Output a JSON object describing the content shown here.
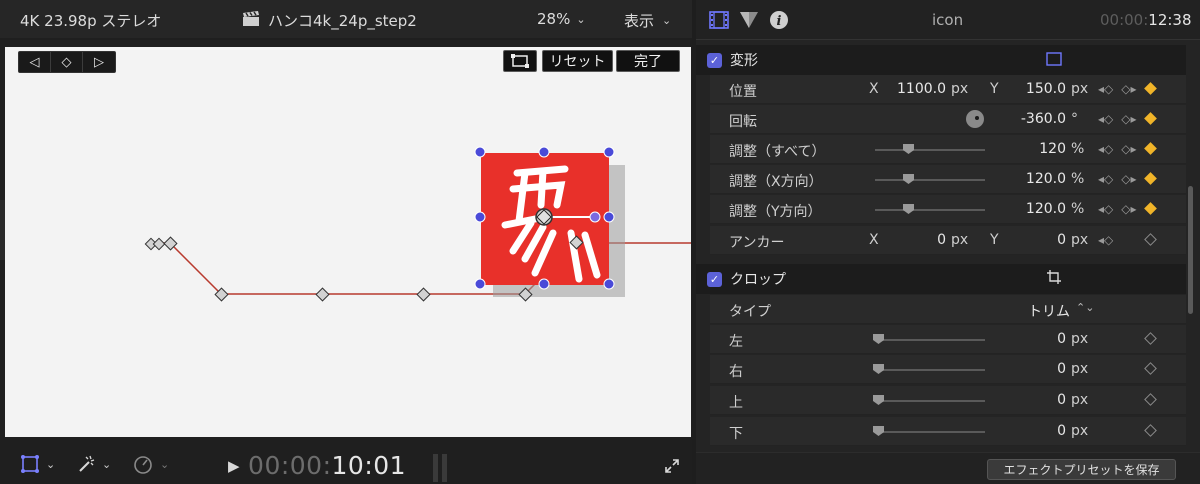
{
  "viewer": {
    "format": "4K 23.98p ステレオ",
    "project_title": "ハンコ4k_24p_step2",
    "zoom": "28%",
    "view_menu": "表示",
    "overlay": {
      "reset_label": "リセット",
      "done_label": "完了"
    },
    "timecode_dim": "00:00:",
    "timecode_bright": "10:01"
  },
  "inspector": {
    "clip_name": "icon",
    "duration_dim": "00:00:",
    "duration_bright": "12:38",
    "transform": {
      "label": "変形",
      "position": {
        "label": "位置",
        "x_axis": "X",
        "x_value": "1100.0",
        "x_unit": "px",
        "y_axis": "Y",
        "y_value": "150.0",
        "y_unit": "px"
      },
      "rotation": {
        "label": "回転",
        "value": "-360.0",
        "unit": "°"
      },
      "scale_all": {
        "label": "調整（すべて）",
        "value": "120",
        "unit": "%"
      },
      "scale_x": {
        "label": "調整（X方向）",
        "value": "120.0",
        "unit": "%"
      },
      "scale_y": {
        "label": "調整（Y方向）",
        "value": "120.0",
        "unit": "%"
      },
      "anchor": {
        "label": "アンカー",
        "x_axis": "X",
        "x_value": "0",
        "x_unit": "px",
        "y_axis": "Y",
        "y_value": "0",
        "y_unit": "px"
      }
    },
    "crop": {
      "label": "クロップ",
      "type": {
        "label": "タイプ",
        "value": "トリム"
      },
      "left": {
        "label": "左",
        "value": "0",
        "unit": "px"
      },
      "right": {
        "label": "右",
        "value": "0",
        "unit": "px"
      },
      "top": {
        "label": "上",
        "value": "0",
        "unit": "px"
      },
      "bottom": {
        "label": "下",
        "value": "0",
        "unit": "px"
      }
    },
    "save_preset_label": "エフェクトプリセットを保存"
  },
  "colors": {
    "accent": "#5c62d8",
    "keyframe_active": "#f0b429",
    "stamp_red": "#e8302a",
    "path_line": "#b83a2e"
  }
}
